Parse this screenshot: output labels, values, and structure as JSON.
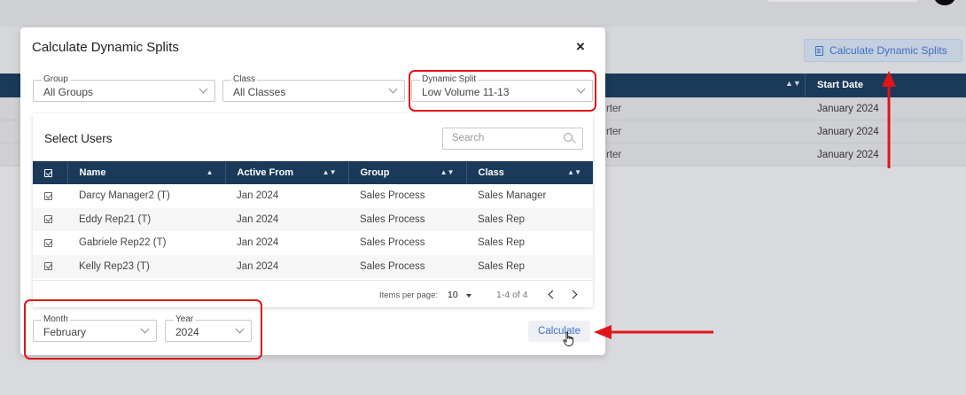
{
  "background": {
    "calc_button_label": "Calculate Dynamic Splits",
    "start_date_header": "Start Date",
    "rows": [
      {
        "partial": "rter",
        "start_date": "January 2024"
      },
      {
        "partial": "rter",
        "start_date": "January 2024"
      },
      {
        "partial": "rter",
        "start_date": "January 2024"
      }
    ]
  },
  "modal": {
    "title": "Calculate Dynamic Splits",
    "close_glyph": "×",
    "filters": {
      "group": {
        "label": "Group",
        "value": "All Groups"
      },
      "class": {
        "label": "Class",
        "value": "All Classes"
      },
      "dynamic_split": {
        "label": "Dynamic Split",
        "value": "Low Volume 11-13"
      }
    },
    "users": {
      "title": "Select Users",
      "search_placeholder": "Search",
      "columns": [
        "Name",
        "Active From",
        "Group",
        "Class"
      ],
      "rows": [
        {
          "name": "Darcy Manager2 (T)",
          "active_from": "Jan 2024",
          "group": "Sales Process",
          "class": "Sales Manager"
        },
        {
          "name": "Eddy Rep21 (T)",
          "active_from": "Jan 2024",
          "group": "Sales Process",
          "class": "Sales Rep"
        },
        {
          "name": "Gabriele Rep22 (T)",
          "active_from": "Jan 2024",
          "group": "Sales Process",
          "class": "Sales Rep"
        },
        {
          "name": "Kelly Rep23 (T)",
          "active_from": "Jan 2024",
          "group": "Sales Process",
          "class": "Sales Rep"
        }
      ],
      "pagination": {
        "items_per_page_label": "Items per page:",
        "items_per_page": "10",
        "range": "1-4 of 4"
      }
    },
    "period": {
      "month": {
        "label": "Month",
        "value": "February"
      },
      "year": {
        "label": "Year",
        "value": "2024"
      }
    },
    "calculate_label": "Calculate"
  },
  "colors": {
    "header_navy": "#1b3a5a",
    "accent_blue": "#3f6fc0",
    "annotation_red": "#e0151a"
  }
}
